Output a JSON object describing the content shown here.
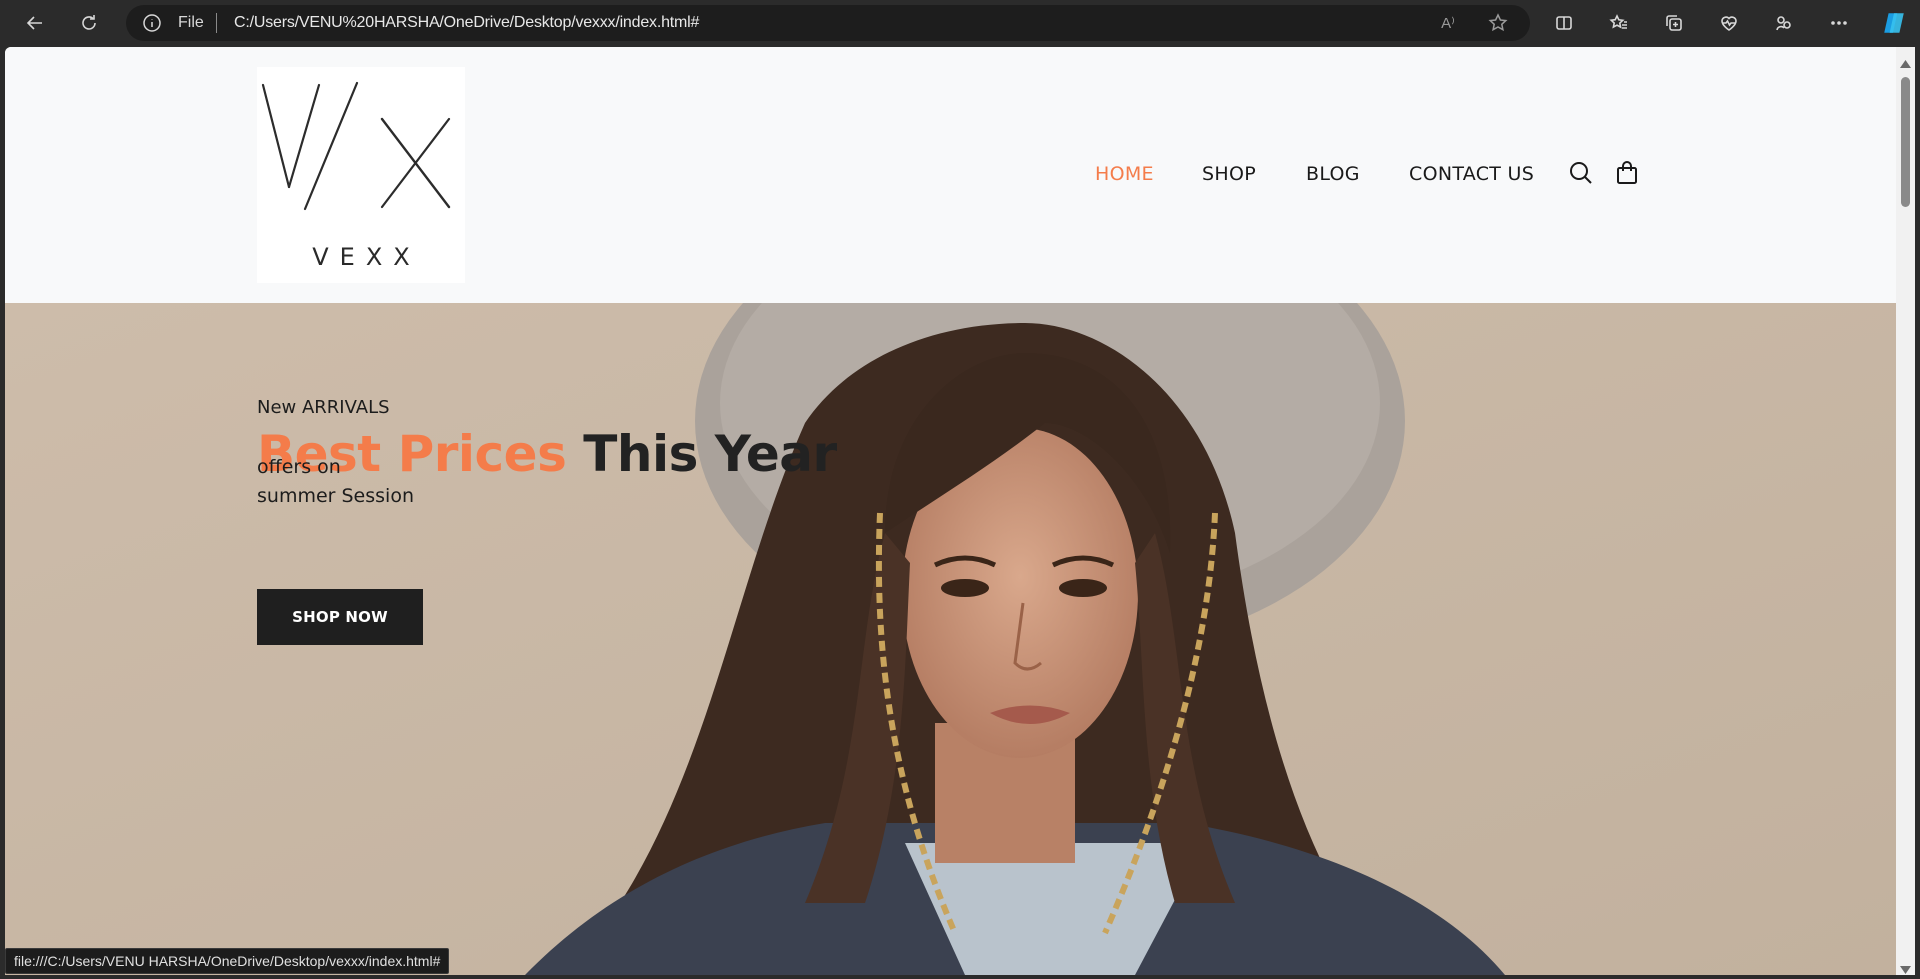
{
  "browser": {
    "address_scheme": "File",
    "address_url": "C:/Users/VENU%20HARSHA/OneDrive/Desktop/vexxx/index.html#",
    "read_aloud_label": "A⁾",
    "status_url": "file:///C:/Users/VENU HARSHA/OneDrive/Desktop/vexxx/index.html#",
    "icons": [
      "back-icon",
      "refresh-icon",
      "info-icon",
      "read-aloud-icon",
      "favorite-star-icon",
      "split-screen-icon",
      "favorites-icon",
      "collections-icon",
      "browser-essentials-icon",
      "profile-icon",
      "more-icon",
      "copilot-icon"
    ]
  },
  "site": {
    "logo_mark": "V/X",
    "logo_word": "VEXX",
    "nav": [
      "HOME",
      "SHOP",
      "BLOG",
      "CONTACT US"
    ],
    "nav_icons": [
      "search-icon",
      "shopping-bag-icon"
    ],
    "accent_color": "#f47c4a"
  },
  "hero": {
    "pre_title": "New ARRIVALS",
    "title_highlight": "Best Prices",
    "title_rest": "This Year",
    "sub_line1": "offers on",
    "sub_line2": "summer Session",
    "cta": "SHOP NOW"
  }
}
